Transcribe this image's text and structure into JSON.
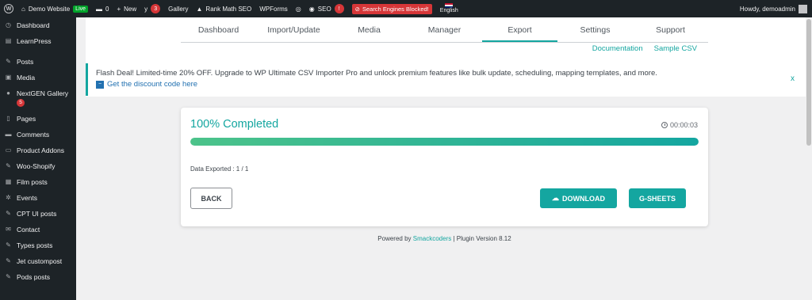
{
  "adminbar": {
    "site_name": "Demo Website",
    "live_label": "Live",
    "comments_count": "0",
    "new_label": "New",
    "yoast_count": "3",
    "gallery_label": "Gallery",
    "rankmath_label": "Rank Math SEO",
    "wpforms_label": "WPForms",
    "seo_label": "SEO",
    "seo_badge": "!",
    "blocked_label": "Search Engines Blocked!",
    "language_label": "English",
    "howdy_label": "Howdy, demoadmin"
  },
  "sidebar": {
    "items": [
      {
        "label": "Dashboard",
        "icon": "dashboard-icon",
        "glyph": "◷"
      },
      {
        "label": "LearnPress",
        "icon": "learnpress-icon",
        "glyph": "▤"
      },
      {
        "label": "Posts",
        "icon": "pin-icon",
        "glyph": "✎"
      },
      {
        "label": "Media",
        "icon": "media-icon",
        "glyph": "▣"
      },
      {
        "label": "NextGEN Gallery",
        "icon": "nextgen-icon",
        "glyph": "●",
        "badge": "5"
      },
      {
        "label": "Pages",
        "icon": "pages-icon",
        "glyph": "▯"
      },
      {
        "label": "Comments",
        "icon": "comments-icon",
        "glyph": "▬"
      },
      {
        "label": "Product Addons",
        "icon": "addons-icon",
        "glyph": "▭"
      },
      {
        "label": "Woo-Shopify",
        "icon": "pin-icon",
        "glyph": "✎"
      },
      {
        "label": "Film posts",
        "icon": "film-icon",
        "glyph": "▦"
      },
      {
        "label": "Events",
        "icon": "gear-icon",
        "glyph": "✲"
      },
      {
        "label": "CPT UI posts",
        "icon": "pin-icon",
        "glyph": "✎"
      },
      {
        "label": "Contact",
        "icon": "mail-icon",
        "glyph": "✉"
      },
      {
        "label": "Types posts",
        "icon": "pin-icon",
        "glyph": "✎"
      },
      {
        "label": "Jet custompost",
        "icon": "pin-icon",
        "glyph": "✎"
      },
      {
        "label": "Pods posts",
        "icon": "pin-icon",
        "glyph": "✎"
      }
    ]
  },
  "tabs": [
    "Dashboard",
    "Import/Update",
    "Media",
    "Manager",
    "Export",
    "Settings",
    "Support"
  ],
  "active_tab": "Export",
  "links": {
    "documentation": "Documentation",
    "sample_csv": "Sample CSV"
  },
  "flash": {
    "message": "Flash Deal! Limited-time 20% OFF. Upgrade to WP Ultimate CSV Importer Pro and unlock premium features like bulk update, scheduling, mapping templates, and more.",
    "link_label": "Get the discount code here",
    "close_label": "x"
  },
  "export_card": {
    "title": "100% Completed",
    "elapsed": "00:00:03",
    "progress_fraction": 1.0,
    "exported_text": "Data Exported : 1 / 1",
    "back_label": "BACK",
    "download_label": "DOWNLOAD",
    "gsheets_label": "G-SHEETS"
  },
  "footer": {
    "prefix": "Powered by",
    "brand": "Smackcoders",
    "suffix": "| Plugin Version 8.12"
  },
  "colors": {
    "accent": "#14a6a0",
    "admin_dark": "#1d2327",
    "danger": "#d63638"
  }
}
